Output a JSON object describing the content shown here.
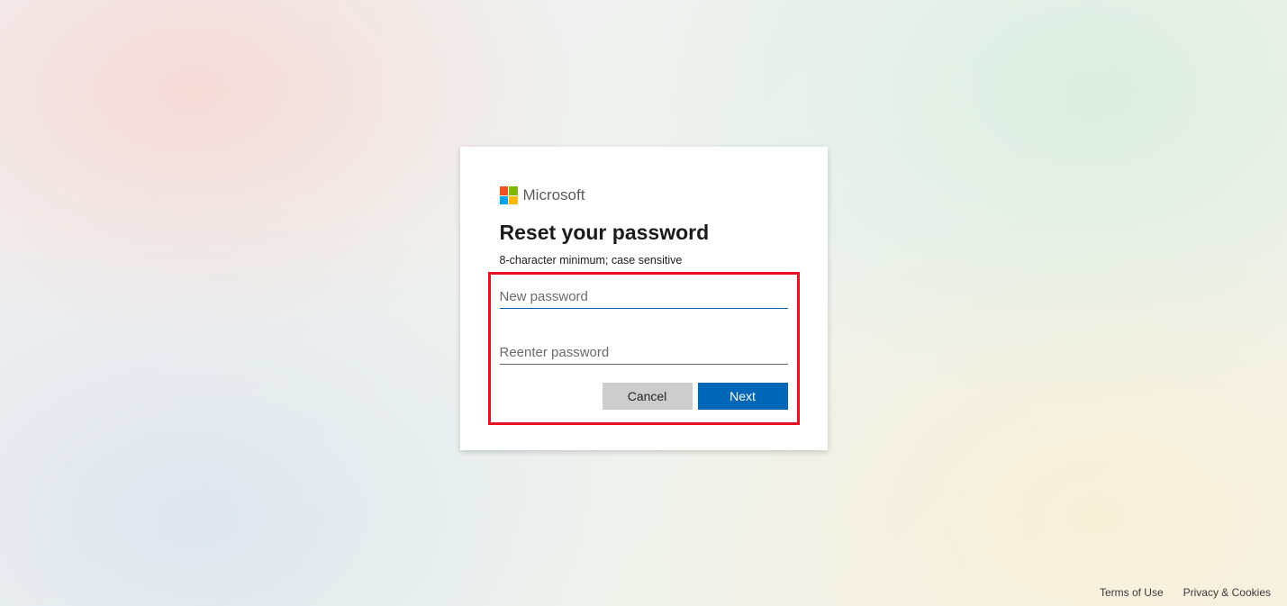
{
  "brand": {
    "name": "Microsoft"
  },
  "page": {
    "title": "Reset your password",
    "hint": "8-character minimum; case sensitive"
  },
  "fields": {
    "new_password": {
      "placeholder": "New password",
      "value": ""
    },
    "reenter_password": {
      "placeholder": "Reenter password",
      "value": ""
    }
  },
  "buttons": {
    "cancel": "Cancel",
    "next": "Next"
  },
  "footer": {
    "terms": "Terms of Use",
    "privacy": "Privacy & Cookies"
  }
}
